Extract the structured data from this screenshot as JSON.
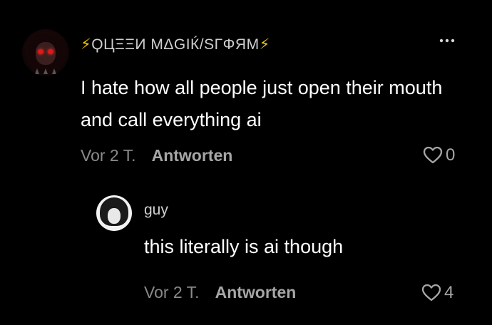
{
  "comment": {
    "username_prefix": "⚡",
    "username_name": "ϘЦΞΞИ МΔGIЌ/SΓΦЯМ",
    "username_suffix": "⚡",
    "more_icon": "more-horizontal-icon",
    "text": "I hate how all people just open their mouth and call everything ai",
    "time": "Vor 2 T.",
    "reply_label": "Antworten",
    "like_count": "0"
  },
  "reply": {
    "username": "guy",
    "text": "this literally is ai though",
    "time": "Vor 2 T.",
    "reply_label": "Antworten",
    "like_count": "4"
  },
  "colors": {
    "background": "#000000",
    "bolt": "#f2c400",
    "muted": "#8a8a8a"
  }
}
